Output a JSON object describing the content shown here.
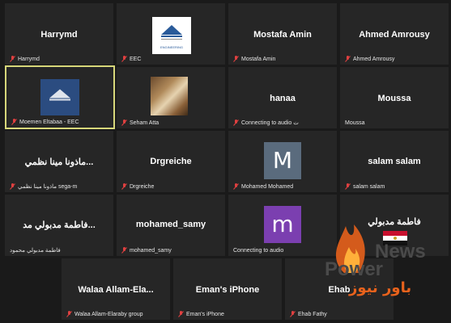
{
  "colors": {
    "background": "#1a1a1a",
    "tile": "#262626",
    "active_border": "#d7d77a",
    "muted_icon": "#e04040",
    "avatar_m1": "#5a6b7d",
    "avatar_m2": "#7b3fb0"
  },
  "tiles": [
    {
      "big": "Harrymd",
      "label": "Harrymd"
    },
    {
      "big": "",
      "label": "EEC"
    },
    {
      "big": "Mostafa Amin",
      "label": "Mostafa Amin"
    },
    {
      "big": "Ahmed Amrousy",
      "label": "Ahmed Amrousy"
    },
    {
      "big": "",
      "label": "Moemen Eltabaa - EEC"
    },
    {
      "big": "",
      "label": "Seham Atta"
    },
    {
      "big": "hanaa",
      "label": "Connecting to audio ت"
    },
    {
      "big": "Moussa",
      "label": "Moussa"
    },
    {
      "big": "ماذونا مينا نظمي...",
      "label": "ماذونا مينا نظمي sega-m"
    },
    {
      "big": "Drgreiche",
      "label": "Drgreiche"
    },
    {
      "big": "",
      "label": "Mohamed Mohamed",
      "avatar": "M"
    },
    {
      "big": "salam salam",
      "label": "salam salam"
    },
    {
      "big": "فاطمة مدبولي مد...",
      "label": "فاطمة مدبولي محمود"
    },
    {
      "big": "mohamed_samy",
      "label": "mohamed_samy"
    },
    {
      "big": "",
      "label": "Connecting to audio",
      "avatar": "m"
    },
    {
      "big": "فاطمة مدبولي",
      "label": ""
    },
    {
      "big": "Walaa Allam-Ela...",
      "label": "Walaa Allam-Elaraby group"
    },
    {
      "big": "Eman's iPhone",
      "label": "Eman's iPhone"
    },
    {
      "big": "Ehab",
      "label": "Ehab Fathy"
    }
  ],
  "logo_text": "ENGINEERING",
  "watermark": {
    "line1": "News",
    "line2": "Power",
    "arabic": "باور نيوز"
  }
}
